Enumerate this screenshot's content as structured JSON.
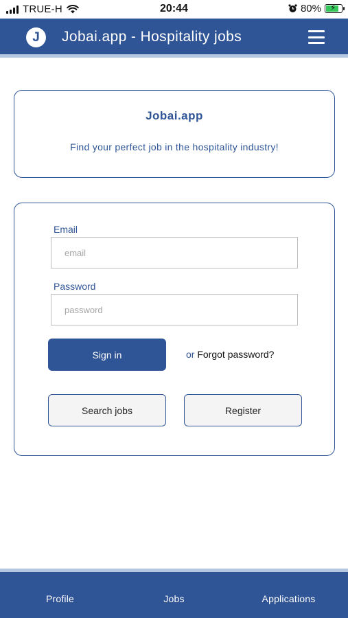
{
  "status_bar": {
    "carrier": "TRUE-H",
    "time": "20:44",
    "battery": "80%",
    "battery_level": 0.8,
    "icons": [
      "signal-icon",
      "wifi-icon",
      "alarm-icon",
      "battery-charging-icon"
    ]
  },
  "header": {
    "logo_letter": "J",
    "title": "Jobai.app - Hospitality jobs",
    "menu_icon": "hamburger-menu-icon"
  },
  "intro": {
    "title": "Jobai.app",
    "subtitle": "Find your perfect job in the hospitality industry!"
  },
  "login": {
    "email_label": "Email",
    "email_placeholder": "email",
    "email_value": "",
    "password_label": "Password",
    "password_placeholder": "password",
    "password_value": "",
    "sign_in_label": "Sign in",
    "or_text": "or",
    "forgot_label": "Forgot password?",
    "search_jobs_label": "Search jobs",
    "register_label": "Register"
  },
  "bottom_nav": {
    "items": [
      {
        "label": "Profile"
      },
      {
        "label": "Jobs"
      },
      {
        "label": "Applications"
      }
    ]
  },
  "colors": {
    "primary": "#2f5597",
    "accent_stripe": "#b8c7e0",
    "battery_fill": "#34c759"
  }
}
